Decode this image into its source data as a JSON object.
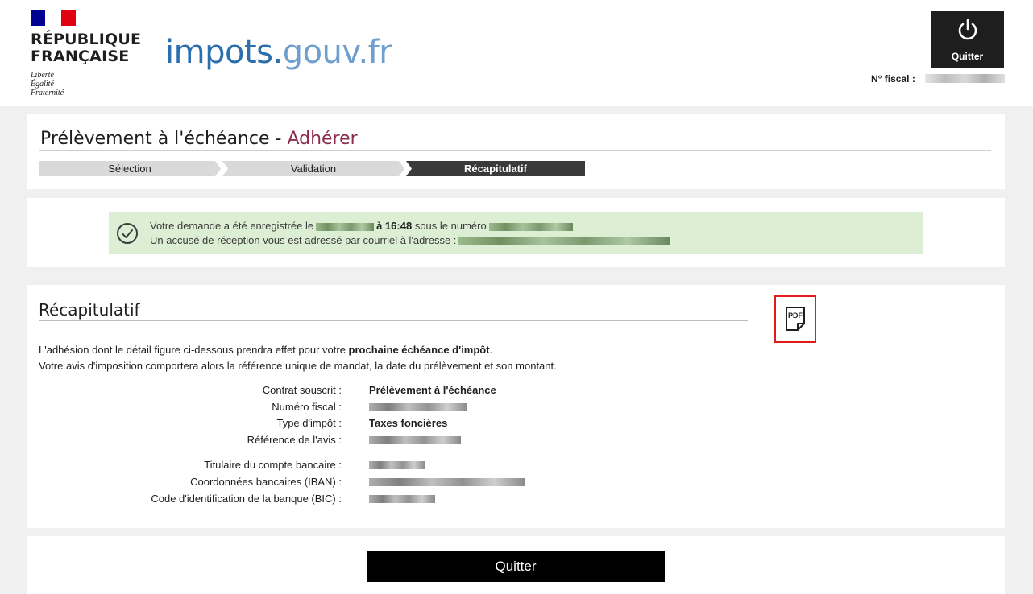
{
  "header": {
    "republic_line1": "RÉPUBLIQUE",
    "republic_line2": "FRANÇAISE",
    "motto1": "Liberté",
    "motto2": "Égalité",
    "motto3": "Fraternité",
    "brand_main": "impots.",
    "brand_suffix": "gouv.fr",
    "quit_label": "Quitter",
    "fiscal_label": "N° fiscal :",
    "icons": {
      "power": "power-icon",
      "flag": "flag-icon"
    }
  },
  "procedure": {
    "title_main": "Prélèvement à l'échéance - ",
    "title_accent": "Adhérer",
    "steps": [
      "Sélection",
      "Validation",
      "Récapitulatif"
    ],
    "active_step": 3
  },
  "confirmation": {
    "line1_prefix": "Votre demande a été enregistrée le",
    "line1_time": "à 16:48",
    "line1_middle": "sous le numéro",
    "line2_prefix": "Un accusé de réception vous est adressé par courriel à l'adresse :",
    "icon": "check-circle-icon",
    "color": "#dcefd5"
  },
  "recap": {
    "title": "Récapitulatif",
    "pdf_icon": "pdf-icon",
    "intro1_prefix": "L'adhésion dont le détail figure ci-dessous prendra effet pour votre ",
    "intro1_bold": "prochaine échéance d'impôt",
    "intro1_suffix": ".",
    "intro2": "Votre avis d'imposition comportera alors la référence unique de mandat, la date du prélèvement et son montant.",
    "fields": [
      {
        "label": "Contrat souscrit :",
        "value": "Prélèvement à l'échéance"
      },
      {
        "label": "Numéro fiscal :",
        "value": ""
      },
      {
        "label": "Type d'impôt :",
        "value": "Taxes foncières"
      },
      {
        "label": "Référence de l'avis :",
        "value": ""
      }
    ],
    "bank_fields": [
      {
        "label": "Titulaire du compte bancaire :",
        "value": ""
      },
      {
        "label": "Coordonnées bancaires (IBAN) :",
        "value": ""
      },
      {
        "label": "Code d'identification de la banque (BIC) :",
        "value": ""
      }
    ]
  },
  "footer": {
    "quit_label": "Quitter"
  },
  "colors": {
    "accent": "#8a2e4a",
    "brand_blue": "#2c6fae",
    "highlight_border": "#e01b1b"
  }
}
